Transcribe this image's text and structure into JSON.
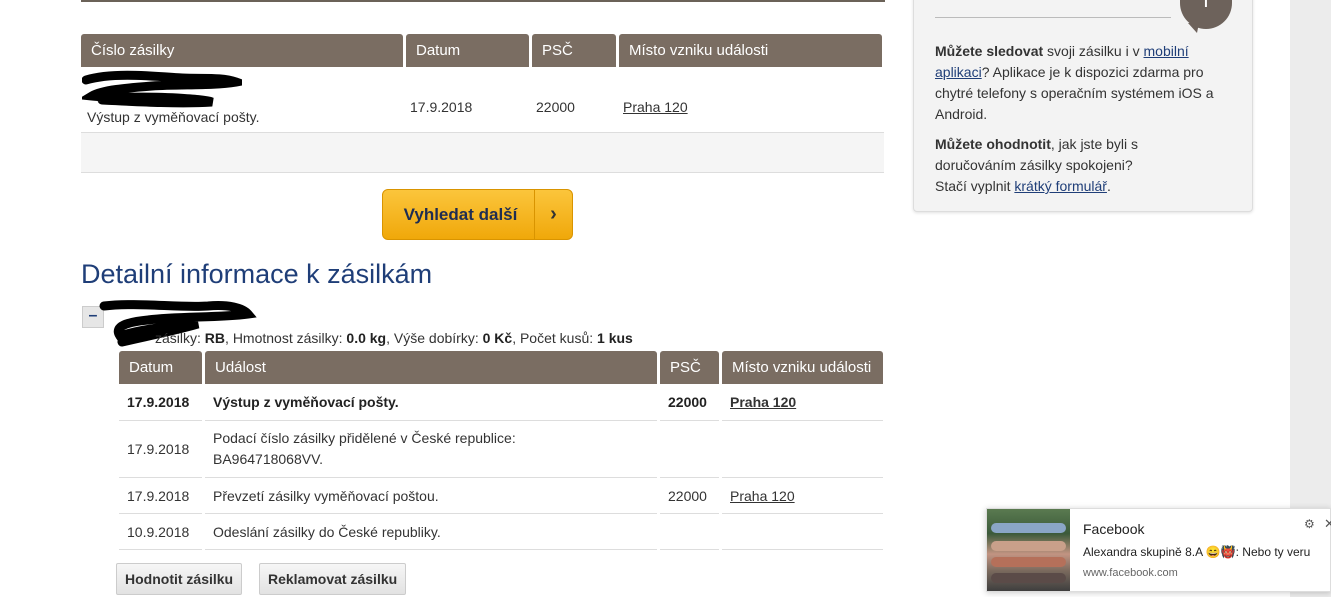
{
  "summary_table": {
    "headers": [
      "Číslo zásilky",
      "Datum",
      "PSČ",
      "Místo vzniku události"
    ],
    "row": {
      "event": "Výstup z vyměňovací pošty.",
      "date": "17.9.2018",
      "psc": "22000",
      "place": "Praha 120"
    }
  },
  "search_button": {
    "label": "Vyhledat další",
    "arrow": "›"
  },
  "detail": {
    "title": "Detailní informace k zásilkám",
    "collapse": "–",
    "info": {
      "type_label": "zásilky:",
      "type_value": "RB",
      "weight_label": "Hmotnost zásilky:",
      "weight_value": "0.0 kg",
      "cod_label": "Výše dobírky:",
      "cod_value": "0 Kč",
      "count_label": "Počet kusů:",
      "count_value": "1 kus"
    },
    "headers": [
      "Datum",
      "Událost",
      "PSČ",
      "Místo vzniku události"
    ],
    "rows": [
      {
        "date": "17.9.2018",
        "event": "Výstup z vyměňovací pošty.",
        "psc": "22000",
        "place": "Praha 120"
      },
      {
        "date": "17.9.2018",
        "event_line1": "Podací číslo zásilky přidělené v České republice:",
        "event_line2": "BA964718068VV.",
        "psc": "",
        "place": ""
      },
      {
        "date": "17.9.2018",
        "event": "Převzetí zásilky vyměňovací poštou.",
        "psc": "22000",
        "place": "Praha 120"
      },
      {
        "date": "10.9.2018",
        "event": "Odeslání zásilky do České republiky.",
        "psc": "",
        "place": ""
      }
    ],
    "buttons": {
      "rate": "Hodnotit zásilku",
      "claim": "Reklamovat zásilku"
    }
  },
  "sidebar": {
    "bubble_icon": "info-icon",
    "bubble_text": "i",
    "p1_bold": "Můžete sledovat",
    "p1_text1": " svoji zásilku i v ",
    "p1_link": "mobilní aplikaci",
    "p1_text2": "? Aplikace je k dispozici zdarma pro chytré telefony s operačním systémem iOS a Android.",
    "p2_bold": "Můžete ohodnotit",
    "p2_text1": ", jak jste byli s doručováním zásilky spokojeni?",
    "p2_text2": "Stačí vyplnit ",
    "p2_link": "krátký formulář",
    "p2_text3": "."
  },
  "notification": {
    "app": "Facebook",
    "message": "Alexandra skupině 8.A 😄👹: Nebo ty veru",
    "source": "www.facebook.com",
    "gear": "⚙",
    "close": "✕"
  },
  "colors": {
    "header_bg": "#7a6d62",
    "title_blue": "#1f3e78",
    "button_yellow": "#f5b21e"
  }
}
